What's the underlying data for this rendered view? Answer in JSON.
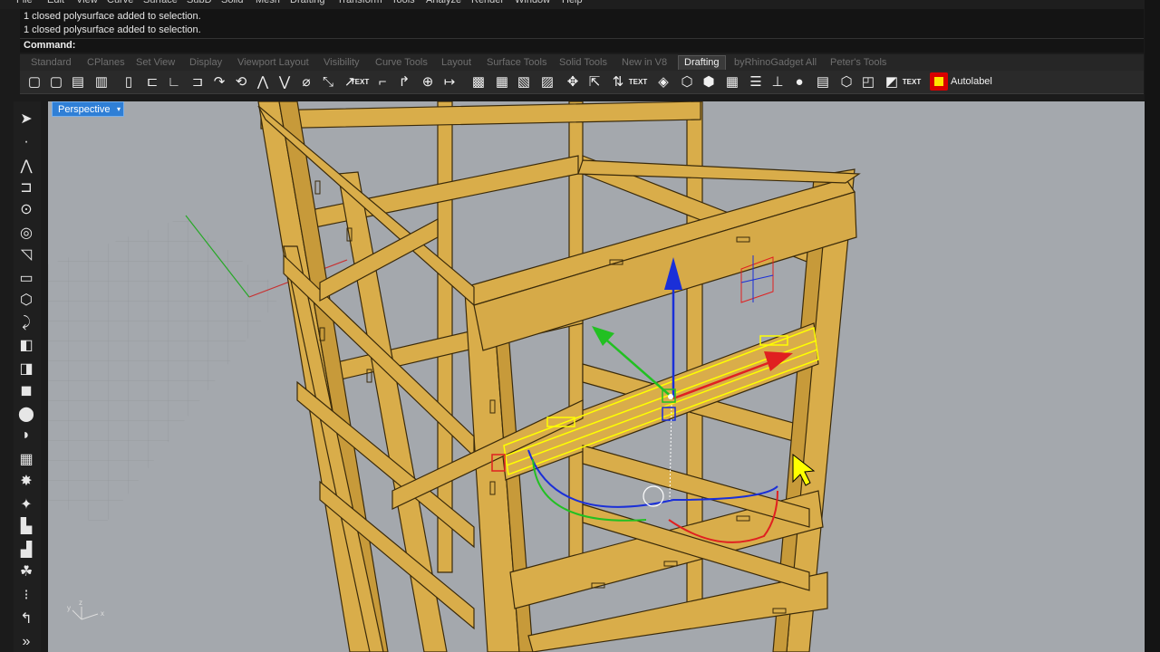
{
  "menu": [
    "File",
    "Edit",
    "View",
    "Curve",
    "Surface",
    "SubD",
    "Solid",
    "Mesh",
    "Drafting",
    "Transform",
    "Tools",
    "Analyze",
    "Render",
    "Window",
    "Help"
  ],
  "history": [
    "1 closed polysurface added to selection.",
    "1 closed polysurface added to selection."
  ],
  "command_label": "Command:",
  "tabs": [
    {
      "label": "Standard"
    },
    {
      "label": "CPlanes"
    },
    {
      "label": "Set View"
    },
    {
      "label": "Display"
    },
    {
      "label": "Viewport Layout"
    },
    {
      "label": "Visibility"
    },
    {
      "label": "Curve Tools"
    },
    {
      "label": "Layout"
    },
    {
      "label": "Surface Tools"
    },
    {
      "label": "Solid Tools"
    },
    {
      "label": "New in V8"
    },
    {
      "label": "Drafting"
    },
    {
      "label": "byRhinoGadget All"
    },
    {
      "label": "Peter's Tools"
    }
  ],
  "active_tab": "Drafting",
  "toolbar_text_icons": [
    "TEXT",
    "TEXT",
    "TEXT"
  ],
  "autolabel_label": "Autolabel",
  "viewport": {
    "name": "Perspective",
    "menu_glyph": "▾"
  },
  "axis_labels": {
    "x": "x",
    "y": "y",
    "z": "z"
  },
  "colors": {
    "accent": "#2f7fd6",
    "wood": "#d9ad4a",
    "highlight": "#ffff00",
    "x_axis": "#e02020",
    "y_axis": "#22c022",
    "z_axis": "#1a2fd8"
  }
}
